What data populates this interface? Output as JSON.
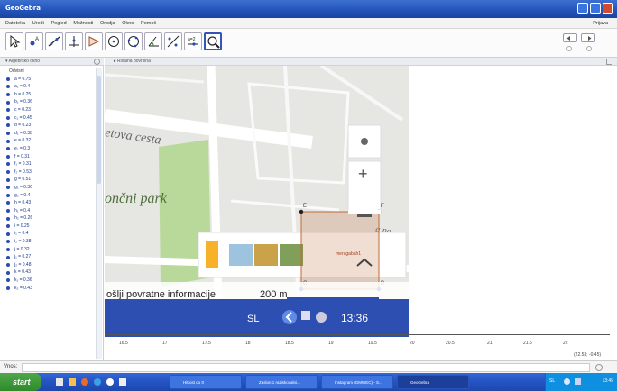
{
  "window": {
    "title": "GeoGebra"
  },
  "menu": [
    "Datoteka",
    "Uredi",
    "Pogled",
    "Možnosti",
    "Orodja",
    "Okno",
    "Pomoč"
  ],
  "menu_right": "Prijava",
  "algebra": {
    "header": "Algebrsko okno",
    "group": "Odvisni",
    "rows": [
      "a = 0.75",
      "a₁ = 0.4",
      "b = 0.25",
      "b₁ = 0.36",
      "c = 0.23",
      "c₁ = 0.45",
      "d = 0.23",
      "d₁ = 0.38",
      "e = 0.32",
      "e₁ = 0.3",
      "f = 0.31",
      "f₁ = 0.31",
      "f₂ = 0.53",
      "g = 0.51",
      "g₁ = 0.36",
      "g₂ = 0.4",
      "h = 0.43",
      "h₁ = 0.4",
      "h₂ = 0.26",
      "i = 0.25",
      "i₁ = 0.4",
      "i₂ = 0.38",
      "j = 0.32",
      "j₁ = 0.27",
      "j₂ = 0.48",
      "k = 0.43",
      "k₁ = 0.36",
      "k₂ = 0.43"
    ]
  },
  "graphics": {
    "header": "Risalna površina",
    "map_labels": {
      "street": "etova cesta",
      "park": "ončni park",
      "feedback": "ošlji povratne informacije",
      "scale": "200 m",
      "edge": "a na",
      "points": [
        "C",
        "D",
        "E",
        "F"
      ],
      "tile_text": "meragabah1"
    },
    "status_bar": {
      "lang": "SL",
      "time": "13:36"
    },
    "axis_ticks": [
      "16.5",
      "17",
      "17.5",
      "18",
      "18.5",
      "19",
      "19.5",
      "20",
      "20.5",
      "21",
      "21.5",
      "22"
    ],
    "corner_readout": "(22.53; -0.45)"
  },
  "input": {
    "label": "Vnos:"
  },
  "taskbar": {
    "start": "start",
    "tasks": [
      "Hitrost do 0",
      "Zaslon 1 raziskovalni...",
      "Instagram (GMWEC) - S...",
      "GeoGebra"
    ],
    "clock": "13:45",
    "lang": "SL"
  },
  "colors": {
    "title_bar": "#2152b8",
    "point_blue": "#2a4bb0",
    "map_park": "#b9d99b",
    "overlay_rect": "#c06a38",
    "tray": "#0f8fe0"
  },
  "icons": [
    "move-icon",
    "point-icon",
    "line-icon",
    "perpendicular-icon",
    "polygon-icon",
    "circle-icon",
    "circle-three-points-icon",
    "angle-icon",
    "reflect-icon",
    "slider-icon",
    "zoom-icon"
  ]
}
